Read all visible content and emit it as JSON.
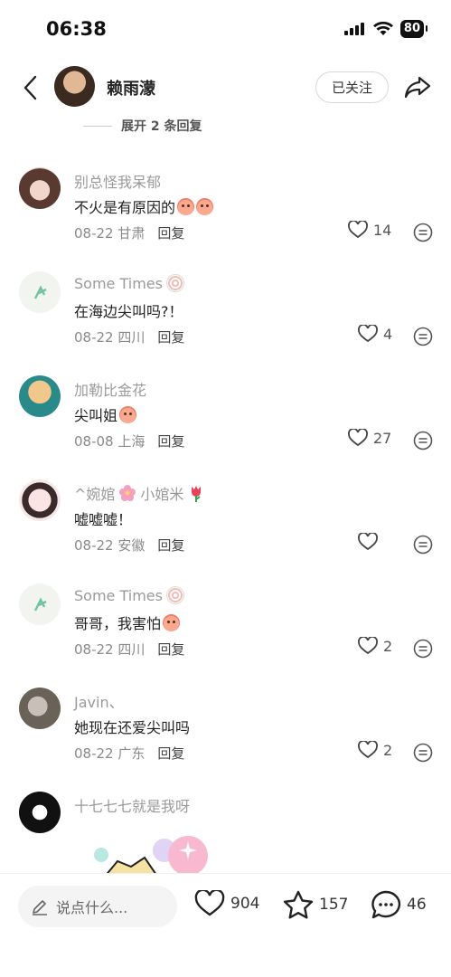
{
  "status": {
    "time": "06:38",
    "battery": "80"
  },
  "header": {
    "name": "赖雨濛",
    "follow_label": "已关注"
  },
  "expand": {
    "label": "展开 2 条回复"
  },
  "comments": [
    {
      "user": "别总怪我呆郁",
      "text": "不火是有原因的",
      "date": "08-22",
      "region": "甘肃",
      "reply": "回复",
      "likes": "14"
    },
    {
      "user": "Some Times",
      "text": "在海边尖叫吗?！",
      "date": "08-22",
      "region": "四川",
      "reply": "回复",
      "likes": "4"
    },
    {
      "user": "加勒比金花",
      "text": "尖叫姐",
      "date": "08-08",
      "region": "上海",
      "reply": "回复",
      "likes": "27"
    },
    {
      "user": "^婉婠",
      "user2": "小婠米",
      "text": "嘘嘘嘘！",
      "date": "08-22",
      "region": "安徽",
      "reply": "回复",
      "likes": ""
    },
    {
      "user": "Some Times",
      "text": "哥哥，我害怕",
      "date": "08-22",
      "region": "四川",
      "reply": "回复",
      "likes": "2"
    },
    {
      "user": "Javin、",
      "text": "她现在还爱尖叫吗",
      "date": "08-22",
      "region": "广东",
      "reply": "回复",
      "likes": "2"
    },
    {
      "user": "十七七七就是我呀"
    }
  ],
  "bottom": {
    "placeholder": "说点什么...",
    "likes": "904",
    "stars": "157",
    "comments": "46"
  },
  "colors": {
    "accent": "#222222",
    "muted": "#9a9a9a"
  }
}
